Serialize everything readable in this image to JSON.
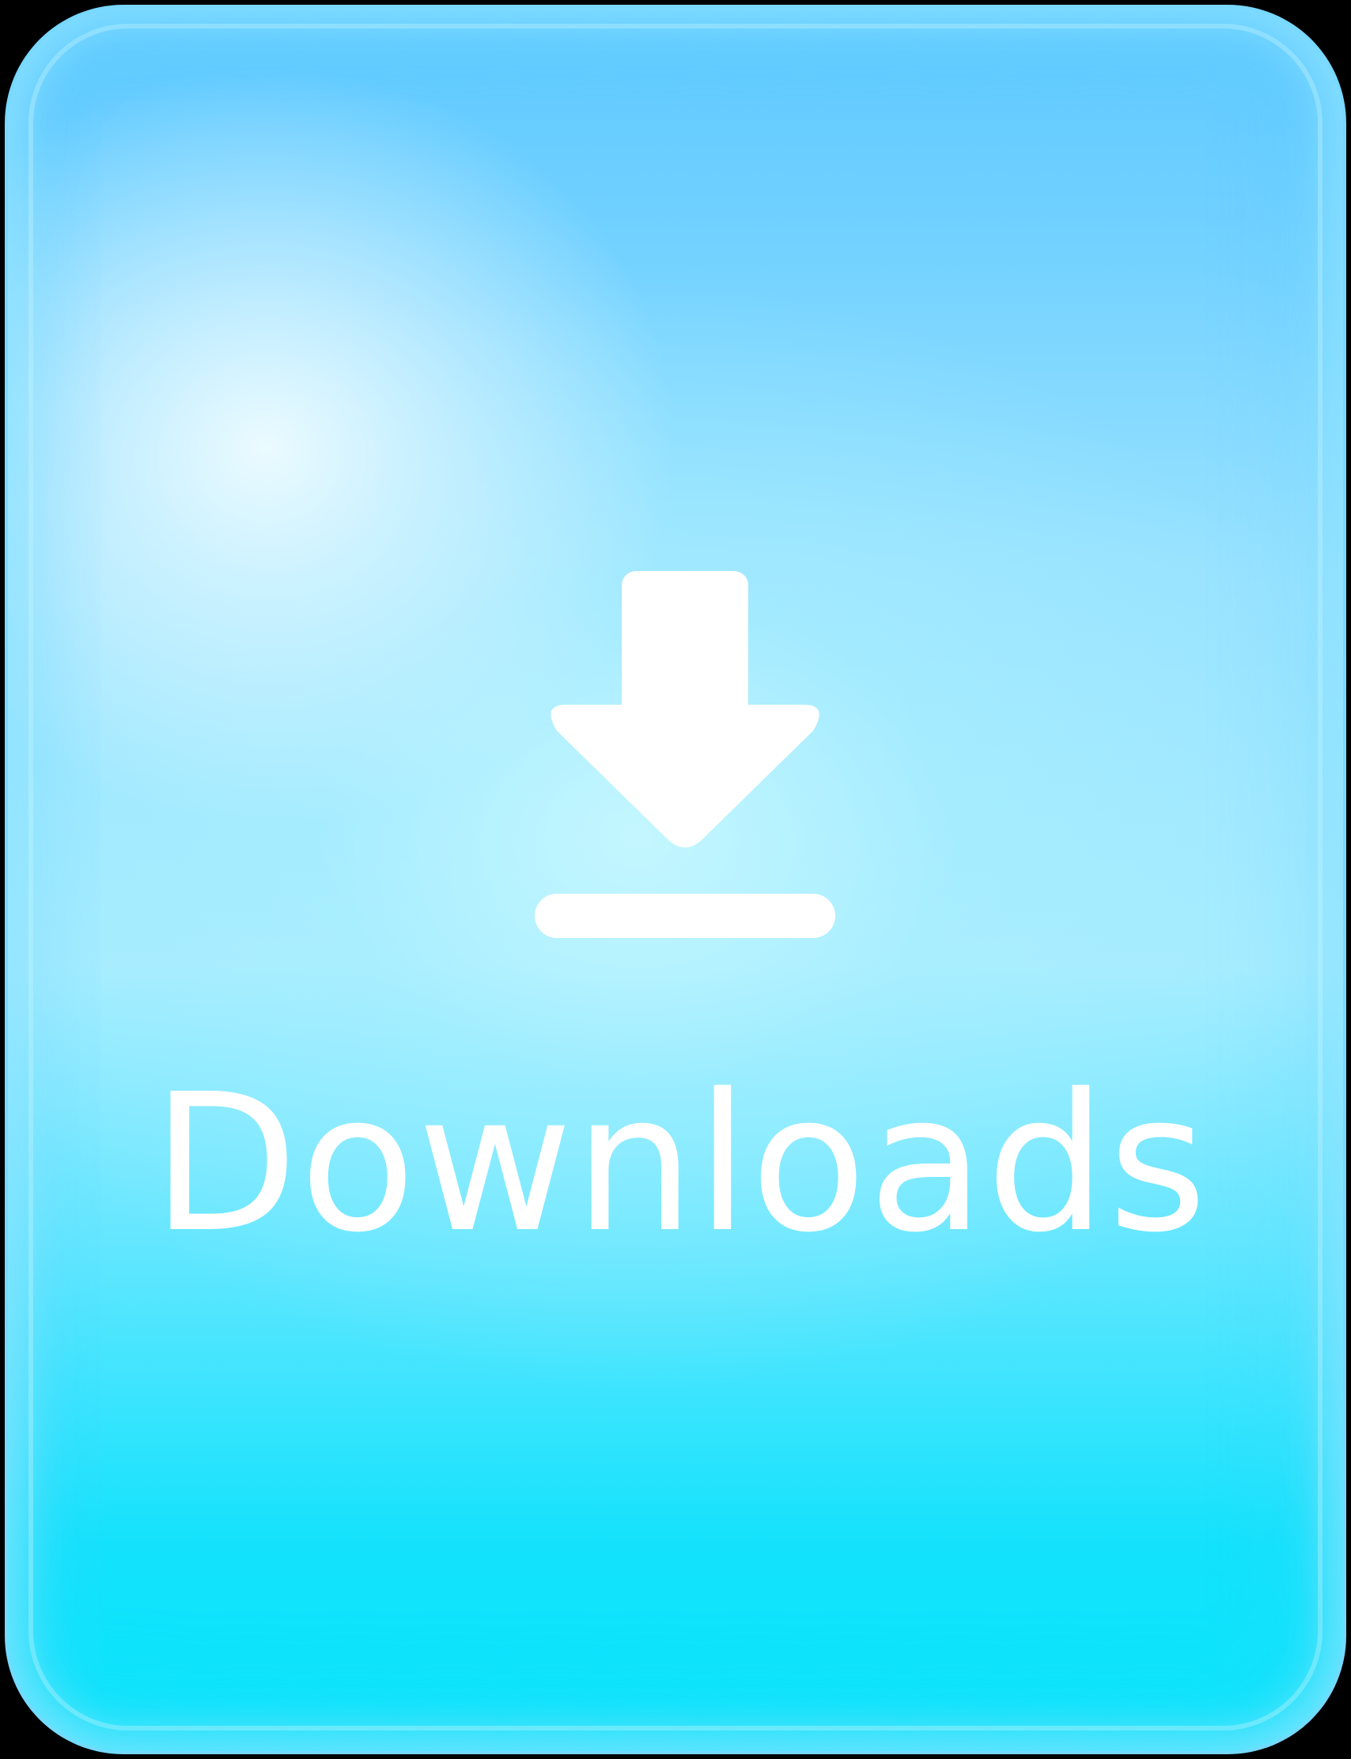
{
  "tile": {
    "label": "Downloads",
    "icon": "download-icon",
    "colors": {
      "top": "#5ec9ff",
      "middle": "#a6ecff",
      "bottom": "#07e6fb",
      "foreground": "#ffffff"
    }
  }
}
